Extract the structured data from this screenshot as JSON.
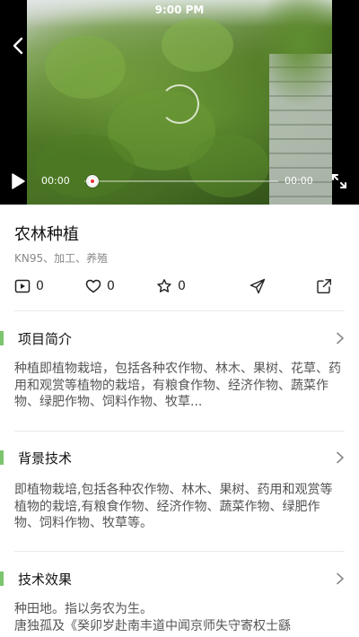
{
  "status_bar": {
    "time": "9:00 PM"
  },
  "video": {
    "current_time": "00:00",
    "duration": "00:00",
    "progress": 0,
    "icons": [
      "back-arrow-icon",
      "loading-spinner-icon",
      "play-icon",
      "fullscreen-icon"
    ]
  },
  "project": {
    "title": "农林种植",
    "tags": "KN95、加工、养殖"
  },
  "actions": {
    "plays": "0",
    "likes": "0",
    "favorites": "0",
    "icons": [
      "play-count-icon",
      "heart-icon",
      "star-icon",
      "send-icon",
      "share-icon"
    ]
  },
  "sections": {
    "intro": {
      "title": "项目简介",
      "body": "种植即植物栽培，包括各种农作物、林木、果树、花草、药用和观赏等植物的栽培，有粮食作物、经济作物、蔬菜作物、绿肥作物、饲料作物、牧草..."
    },
    "background": {
      "title": "背景技术",
      "body": "即植物栽培,包括各种农作物、林木、果树、药用和观赏等植物的栽培,有粮食作物、经济作物、蔬菜作物、绿肥作物、饲料作物、牧草等。"
    },
    "effect": {
      "title": "技术效果",
      "line1": "种田地。指以务农为生。",
      "line2": "唐独孤及《癸卯岁赴南丰道中闻京师失守寄权士繇"
    }
  },
  "colors": {
    "accent_bar": "#7cc46d",
    "video_bg": "#000000",
    "progress_dot": "#e33333"
  }
}
